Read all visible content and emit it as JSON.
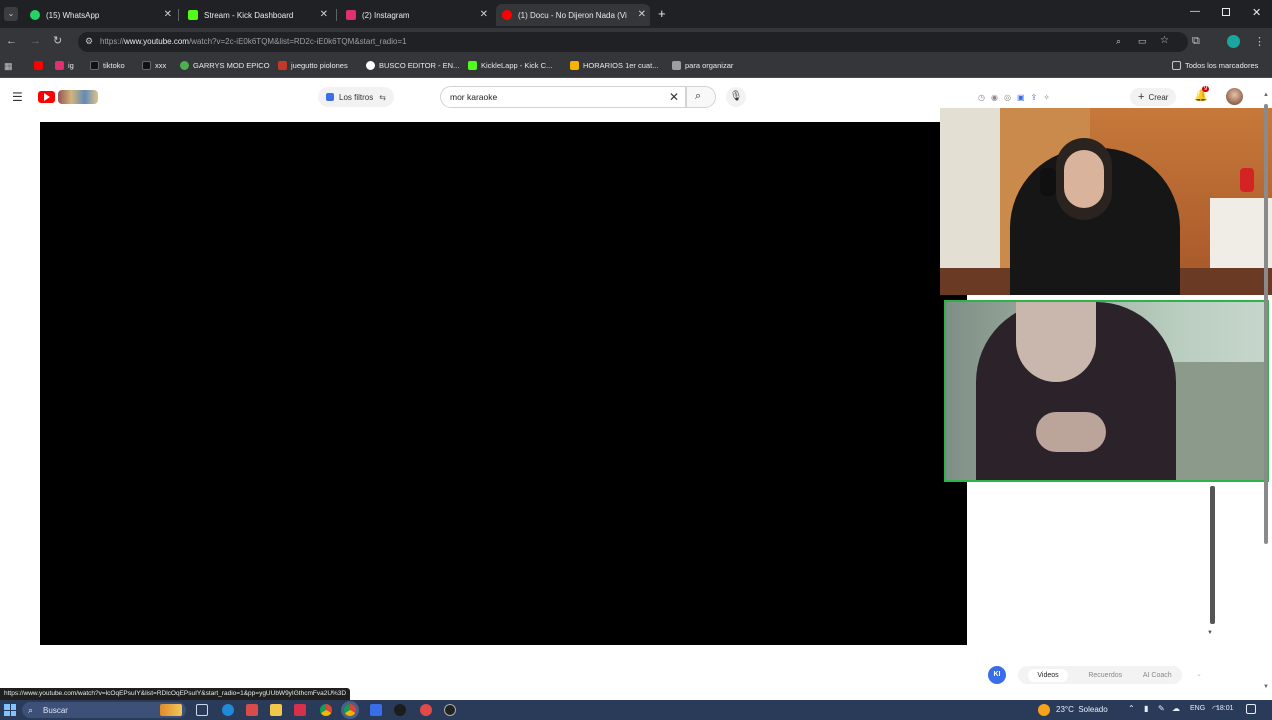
{
  "tabs": [
    {
      "label": "(15) WhatsApp",
      "color": "#25d366"
    },
    {
      "label": "Stream - Kick Dashboard",
      "color": "#53fc18"
    },
    {
      "label": "(2) Instagram",
      "color": "#e1306c"
    },
    {
      "label": "(1) Docu - No Dijeron Nada (Vi",
      "color": "#ff0000",
      "active": true
    }
  ],
  "address": {
    "prefix": "https://",
    "host": "www.youtube.com",
    "path": "/watch?v=2c-iE0k6TQM&list=RD2c-iE0k6TQM&start_radio=1"
  },
  "bookmarks": [
    {
      "label": "",
      "color": "#ff0000"
    },
    {
      "label": "ig",
      "color": "#e1306c"
    },
    {
      "label": "tiktoko",
      "color": "#111111"
    },
    {
      "label": "xxx",
      "color": "#111111"
    },
    {
      "label": "GARRYS MOD EPICO",
      "color": "#4caf50"
    },
    {
      "label": "juegutto piolones",
      "color": "#c0392b"
    },
    {
      "label": "BUSCO EDITOR - EN...",
      "color": "#ffffff"
    },
    {
      "label": "KickleLapp - Kick C...",
      "color": "#53fc18"
    },
    {
      "label": "HORARIOS 1er cuat...",
      "color": "#f4b400"
    },
    {
      "label": "para organizar",
      "color": "#9e9e9e"
    },
    {
      "label": "Todos los marcadores",
      "color": "#9e9e9e"
    }
  ],
  "youtube": {
    "filters_label": "Los filtros",
    "search_value": "mor karaoke",
    "create_label": "Crear",
    "notif_count": "9"
  },
  "right_panel": {
    "avatar_initial": "KI",
    "tabs": [
      "Videos",
      "Recuerdos",
      "AI Coach"
    ]
  },
  "status_url": "https://www.youtube.com/watch?v=lcOqEPsuIY&list=RDlcOqEPsuIY&start_radio=1&pp=ygUUbW9yIGthcmFva2U%3D",
  "taskbar": {
    "search_label": "Buscar",
    "weather": "23°C  Soleado",
    "lang": "ENG",
    "time": "18:01"
  },
  "colors": {
    "chrome_dark": "#202124",
    "chrome_toolbar": "#35363a",
    "cam_border": "#2db34a",
    "taskbar": "#2a3b5a"
  }
}
